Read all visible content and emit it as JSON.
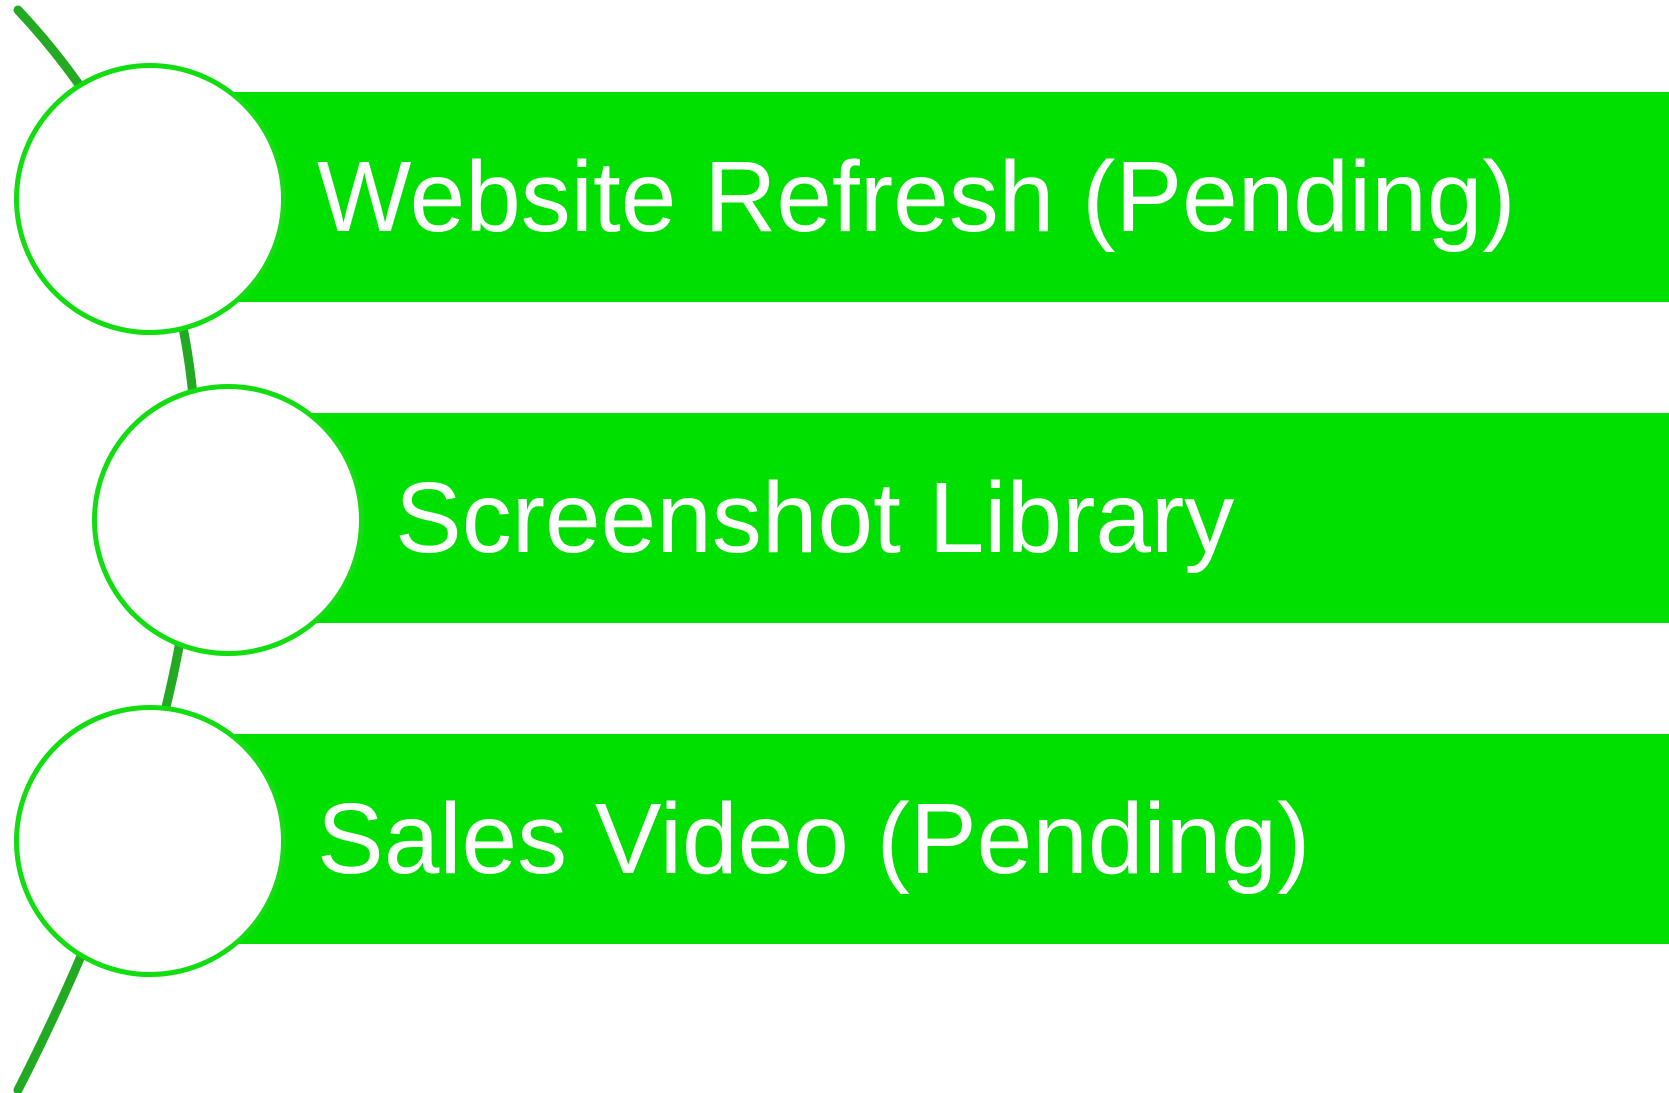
{
  "colors": {
    "band": "#00e000",
    "node_border": "#11dd11",
    "arc": "#22aa22",
    "text": "#ffffff"
  },
  "items": [
    {
      "label": "Website Refresh (Pending)"
    },
    {
      "label": "Screenshot Library"
    },
    {
      "label": "Sales Video (Pending)"
    }
  ]
}
